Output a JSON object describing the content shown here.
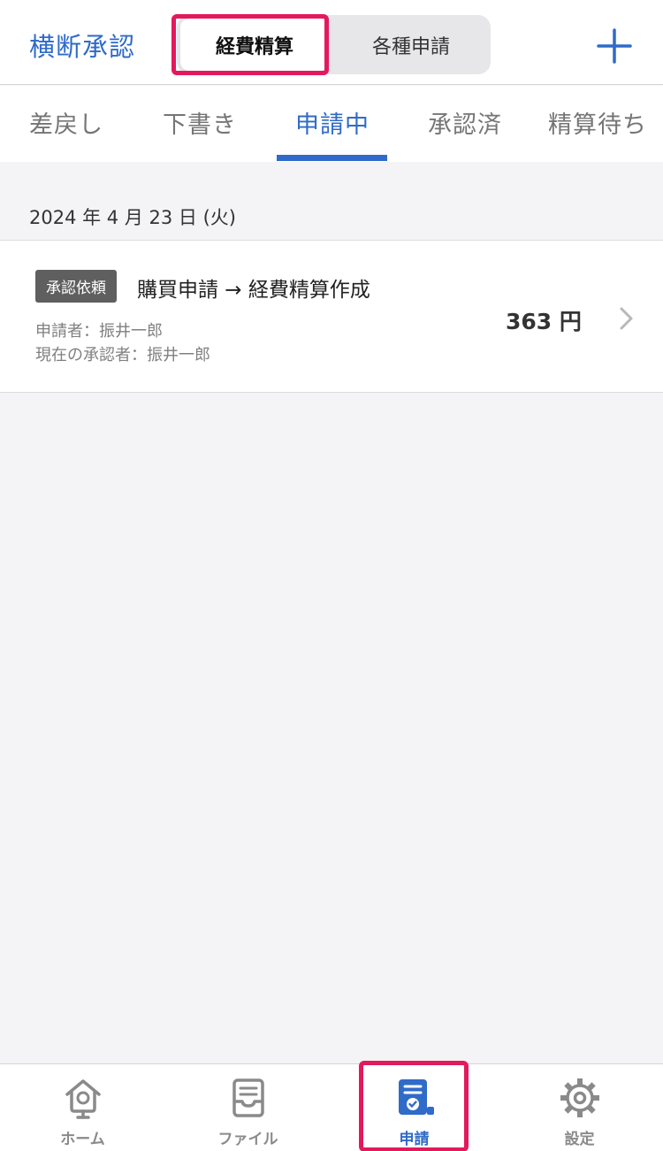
{
  "header": {
    "left_link": "横断承認",
    "segments": [
      {
        "label": "経費精算",
        "selected": true
      },
      {
        "label": "各種申請",
        "selected": false
      }
    ],
    "plus_icon": "plus-icon"
  },
  "status_tabs": [
    {
      "label": "差戻し",
      "active": false
    },
    {
      "label": "下書き",
      "active": false
    },
    {
      "label": "申請中",
      "active": true
    },
    {
      "label": "承認済",
      "active": false
    },
    {
      "label": "精算待ち",
      "active": false
    }
  ],
  "list": {
    "date_header": "2024 年 4 月 23 日 (火)",
    "items": [
      {
        "badge": "承認依頼",
        "title": "購買申請 → 経費精算作成",
        "applicant": "申請者：振井一郎",
        "approver": "現在の承認者：振井一郎",
        "amount": "363 円"
      }
    ]
  },
  "bottom_nav": [
    {
      "label": "ホーム",
      "icon": "home-icon",
      "active": false
    },
    {
      "label": "ファイル",
      "icon": "inbox-tray-icon",
      "active": false
    },
    {
      "label": "申請",
      "icon": "document-check-icon",
      "active": true
    },
    {
      "label": "設定",
      "icon": "gear-icon",
      "active": false
    }
  ],
  "colors": {
    "accent": "#2f6bc8",
    "highlight": "#e3195e",
    "badge_bg": "#5f5f5f",
    "background": "#f4f3f5"
  }
}
